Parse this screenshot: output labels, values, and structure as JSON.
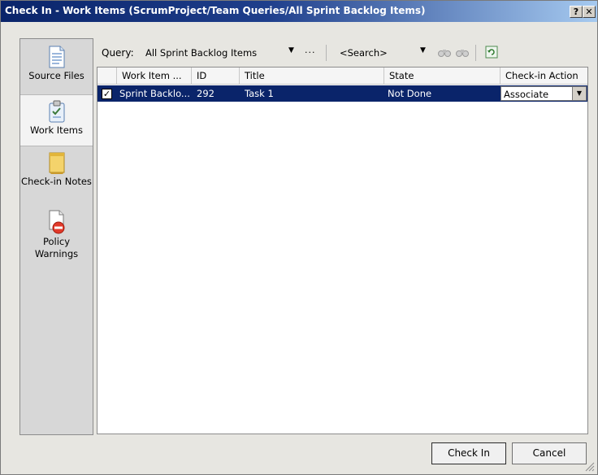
{
  "window": {
    "title": "Check In - Work Items (ScrumProject/Team Queries/All Sprint Backlog Items)",
    "help_label": "?",
    "close_label": "✕"
  },
  "sidebar": {
    "items": [
      {
        "label": "Source Files",
        "icon": "source-files-icon",
        "selected": false
      },
      {
        "label": "Work Items",
        "icon": "work-items-icon",
        "selected": true
      },
      {
        "label": "Check-in Notes",
        "icon": "checkin-notes-icon",
        "selected": false
      },
      {
        "label": "Policy Warnings",
        "icon": "policy-warnings-icon",
        "selected": false
      }
    ]
  },
  "toolbar": {
    "query_label": "Query:",
    "query_value": "All Sprint Backlog Items",
    "more_label": "...",
    "search_value": "<Search>"
  },
  "table": {
    "columns": [
      "Work Item ...",
      "ID",
      "Title",
      "State",
      "Check-in Action"
    ],
    "rows": [
      {
        "checked": true,
        "work_item": "Sprint Backlo...",
        "id": "292",
        "title": "Task 1",
        "state": "Not Done",
        "action": "Associate"
      }
    ]
  },
  "buttons": {
    "check_in": "Check In",
    "cancel": "Cancel"
  },
  "colors": {
    "title_start": "#0a246a",
    "title_end": "#a6caf0",
    "selection": "#0a246a"
  }
}
